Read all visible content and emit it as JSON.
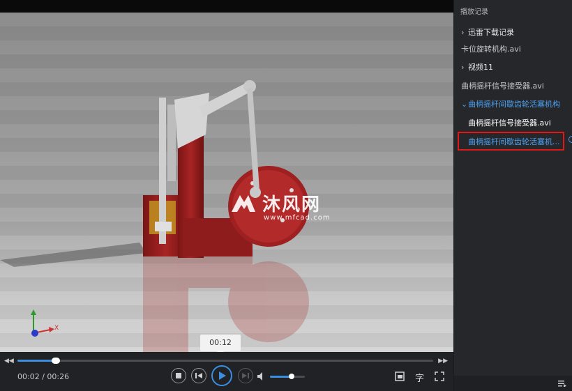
{
  "player": {
    "tooltip_time": "00:12",
    "current_time": "00:02",
    "separator": " / ",
    "duration": "00:26",
    "seek_progress": 0.093,
    "volume_level": 0.62,
    "subtitle_label": "字",
    "watermark_text": "沐风网",
    "watermark_url": "www.mfcad.com",
    "axis_x_label": "X"
  },
  "sidebar": {
    "title": "播放记录",
    "items": [
      {
        "label": "迅雷下载记录",
        "type": "folder"
      },
      {
        "label": "卡位旋转机构.avi",
        "type": "file"
      },
      {
        "label": "视频11",
        "type": "folder"
      },
      {
        "label": "曲柄摇杆信号接受器.avi",
        "type": "file"
      },
      {
        "label": "曲柄摇杆间歇齿轮活塞机构",
        "type": "folder-open"
      },
      {
        "label": "曲柄摇杆信号接受器.avi",
        "type": "sub"
      },
      {
        "label": "曲柄摇杆间歇齿轮活塞机...",
        "type": "active"
      }
    ]
  },
  "colors": {
    "accent": "#3b8fe0",
    "highlight": "#e01818",
    "sidebar_bg": "#25272b",
    "controls_bg": "#202225"
  },
  "icons": [
    "rewind-icon",
    "fast-forward-icon",
    "stop-icon",
    "previous-icon",
    "play-icon",
    "next-icon",
    "volume-icon",
    "picture-in-picture-icon",
    "subtitle-icon",
    "fullscreen-icon",
    "playlist-icon",
    "playing-indicator-icon",
    "chevron-right-icon",
    "chevron-down-icon"
  ]
}
